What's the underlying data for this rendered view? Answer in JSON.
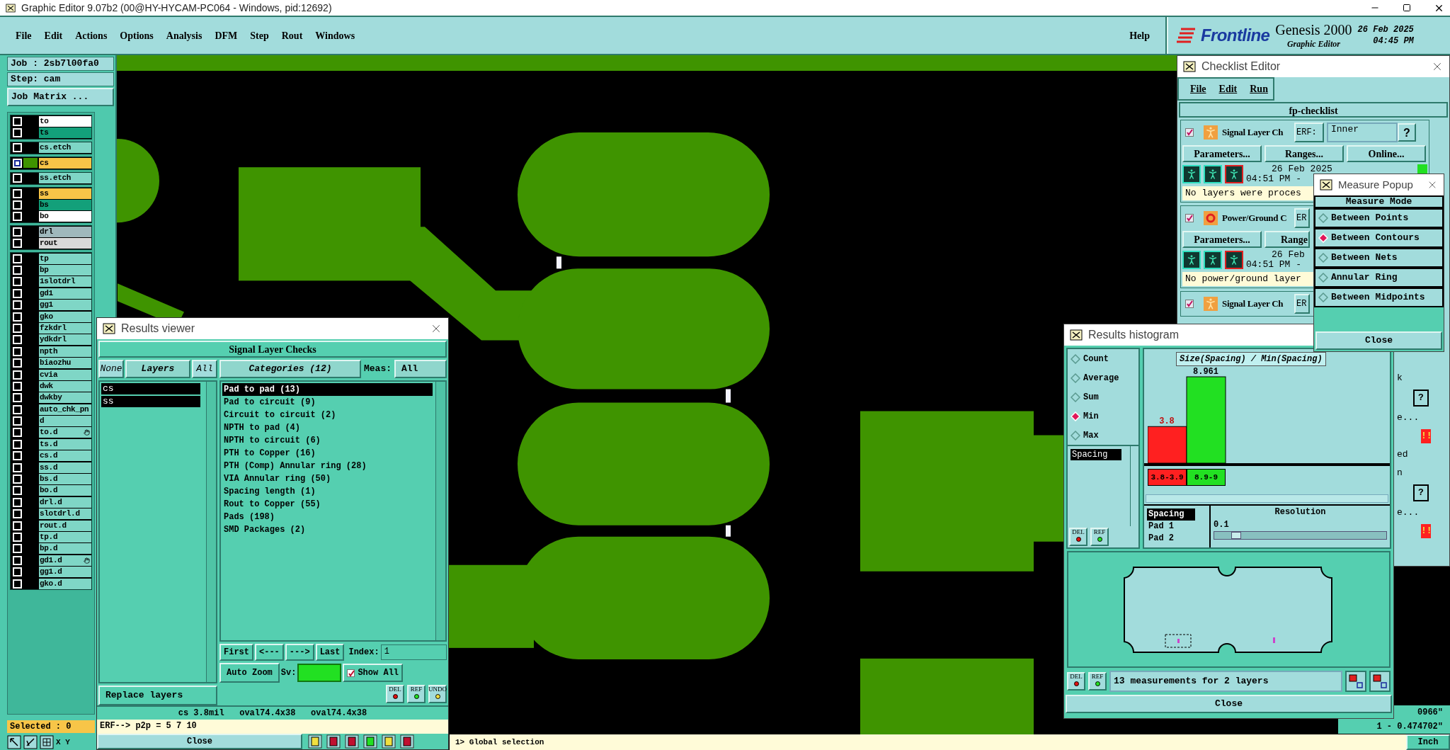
{
  "window": {
    "title": "Graphic Editor 9.07b2 (00@HY-HYCAM-PC064 - Windows, pid:12692)"
  },
  "menu": [
    "File",
    "Edit",
    "Actions",
    "Options",
    "Analysis",
    "DFM",
    "Step",
    "Rout",
    "Windows"
  ],
  "help": "Help",
  "brand": {
    "logo": "Frontline",
    "product": "Genesis 2000",
    "subtitle": "Graphic Editor",
    "date": "26 Feb 2025",
    "time": "04:45 PM"
  },
  "job_panel": {
    "job": "Job : 2sb7l00fa0",
    "step": "Step: cam",
    "matrix_button": "Job Matrix ...",
    "layer_groups": [
      [
        {
          "name": "to",
          "color": "#ffffff",
          "selected": false,
          "marked": false
        },
        {
          "name": "ts",
          "color": "#13a07a",
          "selected": false,
          "marked": false
        }
      ],
      [
        {
          "name": "cs.etch",
          "color": "#7fd6c6",
          "selected": false,
          "marked": false
        }
      ],
      [
        {
          "name": "cs",
          "color": "#f7c548",
          "selected": true,
          "marked": false
        }
      ],
      [
        {
          "name": "ss.etch",
          "color": "#7fd6c6",
          "selected": false,
          "marked": false
        }
      ],
      [
        {
          "name": "ss",
          "color": "#f7c548",
          "selected": false,
          "marked": false
        },
        {
          "name": "bs",
          "color": "#13a07a",
          "selected": false,
          "marked": false
        },
        {
          "name": "bo",
          "color": "#ffffff",
          "selected": false,
          "marked": false
        }
      ],
      [
        {
          "name": "drl",
          "color": "#9fb8bc",
          "selected": false,
          "marked": false
        },
        {
          "name": "rout",
          "color": "#d9d9d9",
          "selected": false,
          "marked": false
        }
      ],
      [
        {
          "name": "tp",
          "color": "#7fd6c6",
          "selected": false,
          "marked": false
        },
        {
          "name": "bp",
          "color": "#7fd6c6",
          "selected": false,
          "marked": false
        },
        {
          "name": "1slotdrl",
          "color": "#7fd6c6",
          "selected": false,
          "marked": false
        },
        {
          "name": "gd1",
          "color": "#7fd6c6",
          "selected": false,
          "marked": false
        },
        {
          "name": "gg1",
          "color": "#7fd6c6",
          "selected": false,
          "marked": false
        },
        {
          "name": "gko",
          "color": "#7fd6c6",
          "selected": false,
          "marked": false
        },
        {
          "name": "fzkdrl",
          "color": "#7fd6c6",
          "selected": false,
          "marked": false
        },
        {
          "name": "ydkdrl",
          "color": "#7fd6c6",
          "selected": false,
          "marked": false
        },
        {
          "name": "npth",
          "color": "#7fd6c6",
          "selected": false,
          "marked": false
        },
        {
          "name": "biaozhu",
          "color": "#7fd6c6",
          "selected": false,
          "marked": false
        },
        {
          "name": "cvia",
          "color": "#7fd6c6",
          "selected": false,
          "marked": false
        },
        {
          "name": "dwk",
          "color": "#7fd6c6",
          "selected": false,
          "marked": false
        },
        {
          "name": "dwkby",
          "color": "#7fd6c6",
          "selected": false,
          "marked": false
        },
        {
          "name": "auto_chk_pn",
          "color": "#7fd6c6",
          "selected": false,
          "marked": false
        },
        {
          "name": "d",
          "color": "#7fd6c6",
          "selected": false,
          "marked": false
        },
        {
          "name": "to.d",
          "color": "#7fd6c6",
          "selected": false,
          "marked": true
        },
        {
          "name": "ts.d",
          "color": "#7fd6c6",
          "selected": false,
          "marked": false
        },
        {
          "name": "cs.d",
          "color": "#7fd6c6",
          "selected": false,
          "marked": false
        },
        {
          "name": "ss.d",
          "color": "#7fd6c6",
          "selected": false,
          "marked": false
        },
        {
          "name": "bs.d",
          "color": "#7fd6c6",
          "selected": false,
          "marked": false
        },
        {
          "name": "bo.d",
          "color": "#7fd6c6",
          "selected": false,
          "marked": false
        },
        {
          "name": "drl.d",
          "color": "#7fd6c6",
          "selected": false,
          "marked": false
        },
        {
          "name": "slotdrl.d",
          "color": "#7fd6c6",
          "selected": false,
          "marked": false
        },
        {
          "name": "rout.d",
          "color": "#7fd6c6",
          "selected": false,
          "marked": false
        },
        {
          "name": "tp.d",
          "color": "#7fd6c6",
          "selected": false,
          "marked": false
        },
        {
          "name": "bp.d",
          "color": "#7fd6c6",
          "selected": false,
          "marked": false
        },
        {
          "name": "gd1.d",
          "color": "#7fd6c6",
          "selected": false,
          "marked": true
        },
        {
          "name": "gg1.d",
          "color": "#7fd6c6",
          "selected": false,
          "marked": false
        },
        {
          "name": "gko.d",
          "color": "#7fd6c6",
          "selected": false,
          "marked": false
        }
      ]
    ],
    "selected": "Selected : 0",
    "xy": "X Y"
  },
  "results_viewer": {
    "title": "Results viewer",
    "heading": "Signal Layer Checks",
    "layer_buttons": [
      "None",
      "Layers",
      "All"
    ],
    "layers": [
      {
        "name": "cs",
        "selected": true
      },
      {
        "name": "ss",
        "selected": true
      }
    ],
    "categories_label": "Categories (12)",
    "meas_label": "Meas:",
    "meas_value": "All",
    "categories": [
      {
        "label": "Pad to pad (13)",
        "selected": true
      },
      {
        "label": "Pad to circuit (9)",
        "selected": false
      },
      {
        "label": "Circuit to circuit (2)",
        "selected": false
      },
      {
        "label": "NPTH to pad (4)",
        "selected": false
      },
      {
        "label": "NPTH to circuit (6)",
        "selected": false
      },
      {
        "label": "PTH to Copper (16)",
        "selected": false
      },
      {
        "label": "PTH (Comp) Annular ring (28)",
        "selected": false
      },
      {
        "label": "VIA Annular ring (50)",
        "selected": false
      },
      {
        "label": "Spacing length (1)",
        "selected": false
      },
      {
        "label": "Rout to Copper (55)",
        "selected": false
      },
      {
        "label": "Pads (198)",
        "selected": false
      },
      {
        "label": "SMD Packages (2)",
        "selected": false
      }
    ],
    "nav": [
      "First",
      "<---",
      "--->",
      "Last"
    ],
    "index_label": "Index:",
    "index_value": "1",
    "auto_zoom": "Auto Zoom",
    "sv_label": "Sv:",
    "show_all": {
      "label": "Show All",
      "checked": true
    },
    "replace": "Replace layers",
    "tools": [
      "DEL",
      "REF",
      "UNDO"
    ],
    "status": "cs 3.8mil   oval74.4x38   oval74.4x38",
    "erf": "ERF--> p2p = 5 7 10",
    "close": "Close"
  },
  "checklist": {
    "title": "Checklist Editor",
    "menu": [
      "File",
      "Edit",
      "Run"
    ],
    "name": "fp-checklist",
    "checks": [
      {
        "checked": true,
        "kind": "signal",
        "name": "Signal Layer Ch",
        "erf": "ERF:",
        "erf_value": "Inner",
        "help": "?",
        "buttons": [
          "Parameters...",
          "Ranges...",
          "Online..."
        ],
        "date": "26 Feb 2025",
        "time": "04:51 PM -",
        "message": "No layers were proces"
      },
      {
        "checked": true,
        "kind": "power",
        "name": "Power/Ground C",
        "erf": "ER",
        "buttons": [
          "Parameters...",
          "Range"
        ],
        "date": "26 Feb",
        "time": "04:51 PM -",
        "message": "No power/ground layer"
      },
      {
        "checked": true,
        "kind": "signal",
        "name": "Signal Layer Ch",
        "erf": "ER"
      }
    ],
    "peek": [
      "k",
      "?",
      "e...",
      "!!",
      "ed",
      "n",
      "?",
      "e...",
      "!!"
    ]
  },
  "measure_popup": {
    "title": "Measure Popup",
    "heading": "Measure Mode",
    "modes": [
      {
        "label": "Between Points",
        "selected": false
      },
      {
        "label": "Between Contours",
        "selected": true
      },
      {
        "label": "Between Nets",
        "selected": false
      },
      {
        "label": "Annular Ring",
        "selected": false
      },
      {
        "label": "Between Midpoints",
        "selected": false
      }
    ],
    "close": "Close"
  },
  "histogram": {
    "title": "Results histogram",
    "modes": [
      {
        "label": "Count",
        "selected": false
      },
      {
        "label": "Average",
        "selected": false
      },
      {
        "label": "Sum",
        "selected": false
      },
      {
        "label": "Min",
        "selected": true
      },
      {
        "label": "Max",
        "selected": false
      }
    ],
    "fields": [
      {
        "label": "Spacing",
        "selected": true
      }
    ],
    "tools": [
      "DEL",
      "REF"
    ],
    "chart_data": {
      "type": "bar",
      "title": "Size(Spacing) / Min(Spacing)",
      "categories": [
        "3.8-3.9",
        "8.9-9"
      ],
      "values": [
        3.8,
        8.961
      ],
      "data_labels": true,
      "value_labels": [
        "3.8",
        "8.961"
      ]
    },
    "bottom_tools": [
      "DEL",
      "REF"
    ],
    "attributes": [
      {
        "label": "Spacing",
        "selected": true
      },
      {
        "label": "Pad 1",
        "selected": false
      },
      {
        "label": "Pad 2",
        "selected": false
      }
    ],
    "resolution_label": "Resolution",
    "resolution_value": "0.1",
    "resolution": {
      "level": 0.1
    },
    "summary": "13 measurements for 2 layers",
    "close": "Close"
  },
  "coordinates": [
    "0966\"",
    "1 - 0.474702\""
  ],
  "command_line": "1> Global selection",
  "units": "Inch"
}
